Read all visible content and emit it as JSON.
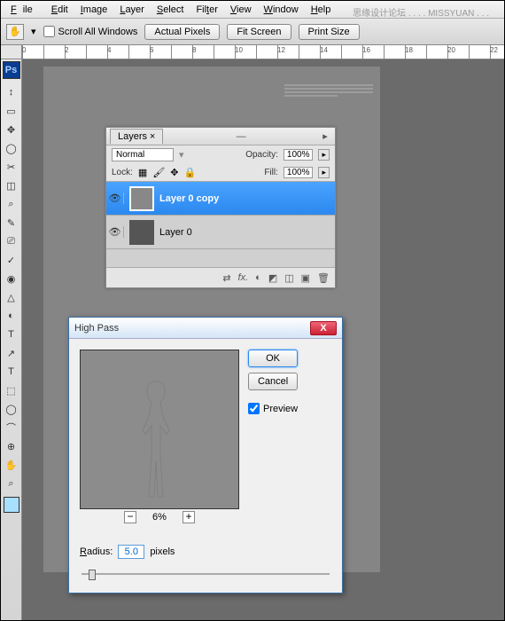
{
  "menu": {
    "items": [
      "File",
      "Edit",
      "Image",
      "Layer",
      "Select",
      "Filter",
      "View",
      "Window",
      "Help"
    ]
  },
  "watermark": "思缘设计论坛 . . . . MISSYUAN . . .",
  "options": {
    "scroll_label": "Scroll All Windows",
    "actual": "Actual Pixels",
    "fit": "Fit Screen",
    "print": "Print Size"
  },
  "ruler": {
    "nums": [
      "0",
      "2",
      "4",
      "6",
      "8",
      "10",
      "12",
      "14",
      "16",
      "18",
      "20",
      "22"
    ]
  },
  "ps_badge": "Ps",
  "tools": [
    "↕",
    "▭",
    "✥",
    "◯",
    "✂",
    "◫",
    "⌕",
    "✎",
    "⎚",
    "✓",
    "◉",
    "△",
    "◐",
    "T",
    "↗",
    "⬚",
    "◯",
    "⌒",
    "⊕",
    "✋",
    "⌕"
  ],
  "layers": {
    "tab": "Layers",
    "mode": "Normal",
    "opacity_label": "Opacity:",
    "opacity_val": "100%",
    "lock_label": "Lock:",
    "fill_label": "Fill:",
    "fill_val": "100%",
    "items": [
      {
        "name": "Layer 0 copy",
        "selected": true
      },
      {
        "name": "Layer 0",
        "selected": false
      }
    ],
    "foot_icons": [
      "⇄",
      "⎘",
      "fx.",
      "◐",
      "◩",
      "◫",
      "▣",
      "🗑"
    ]
  },
  "dialog": {
    "title": "High Pass",
    "ok": "OK",
    "cancel": "Cancel",
    "preview_label": "Preview",
    "preview_checked": true,
    "zoom": "6%",
    "radius_label": "Radius:",
    "radius_val": "5.0",
    "radius_unit": "pixels"
  }
}
